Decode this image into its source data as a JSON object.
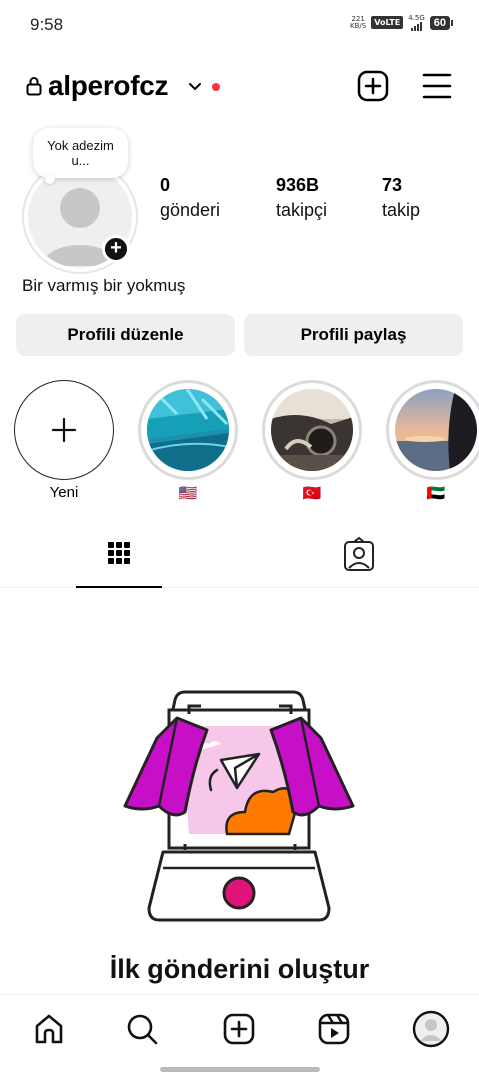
{
  "status_bar": {
    "time": "9:58",
    "speed_value": "221",
    "speed_unit": "KB/S",
    "volte": "VoLTE",
    "network": "4.5G",
    "battery": "60"
  },
  "header": {
    "username": "alperofcz",
    "notification_dot_color": "#ff3040"
  },
  "profile": {
    "note_text": "Yok adezim u...",
    "stats": {
      "posts": {
        "value": "0",
        "label": "gönderi"
      },
      "followers": {
        "value": "936B",
        "label": "takipçi"
      },
      "following": {
        "value": "73",
        "label": "takip"
      }
    },
    "bio": "Bir varmış bir yokmuş",
    "buttons": {
      "edit": "Profili düzenle",
      "share": "Profili paylaş"
    }
  },
  "highlights": [
    {
      "label": "Yeni",
      "type": "new"
    },
    {
      "label": "🇺🇸",
      "type": "story"
    },
    {
      "label": "🇹🇷",
      "type": "story"
    },
    {
      "label": "🇦🇪",
      "type": "story"
    }
  ],
  "tabs": [
    {
      "icon": "grid-icon",
      "active": true
    },
    {
      "icon": "tagged-icon",
      "active": false
    }
  ],
  "empty_state": {
    "title": "İlk gönderini oluştur"
  },
  "bottom_nav": [
    "home-icon",
    "search-icon",
    "create-icon",
    "reels-icon",
    "profile-icon"
  ],
  "colors": {
    "accent_magenta": "#c80fc8",
    "accent_orange": "#ff7a00",
    "accent_pink": "#e0137a"
  }
}
